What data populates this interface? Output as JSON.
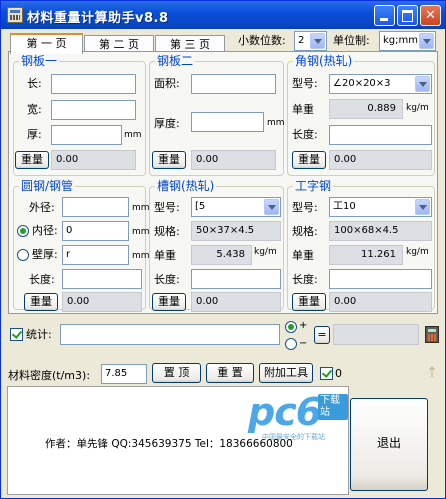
{
  "window": {
    "title": "材料重量计算助手v8.8"
  },
  "tabs": [
    "第 一 页",
    "第 二 页",
    "第 三 页"
  ],
  "toolbar": {
    "decimals_label": "小数位数:",
    "decimals_value": "2",
    "unit_label": "单位制:",
    "unit_value": "kg;mm"
  },
  "plate1": {
    "title": "钢板一",
    "length_label": "长:",
    "width_label": "宽:",
    "thickness_label": "厚:",
    "thickness_unit": "mm",
    "button": "重量",
    "result": "0.00"
  },
  "plate2": {
    "title": "钢板二",
    "area_label": "面积:",
    "thickness_label": "厚度:",
    "thickness_unit": "mm",
    "button": "重量",
    "result": "0.00"
  },
  "angle": {
    "title": "角钢(热轧)",
    "model_label": "型号:",
    "model_value": "∠20×20×3",
    "unit_weight_label": "单重",
    "unit_weight_value": "0.889",
    "unit_weight_unit": "kg/m",
    "length_label": "长度:",
    "button": "重量",
    "result": "0.00"
  },
  "pipe": {
    "title": "圆钢/钢管",
    "outer_label": "外径:",
    "outer_unit": "mm",
    "inner_label": "内径:",
    "inner_value": "0",
    "inner_unit": "mm",
    "wall_label": "壁厚:",
    "wall_value": "r",
    "wall_unit": "mm",
    "length_label": "长度:",
    "button": "重量",
    "result": "0.00"
  },
  "channel": {
    "title": "槽钢(热轧)",
    "model_label": "型号:",
    "model_value": "[5",
    "spec_label": "规格:",
    "spec_value": "50×37×4.5",
    "unit_weight_label": "单重",
    "unit_weight_value": "5.438",
    "unit_weight_unit": "kg/m",
    "length_label": "长度:",
    "button": "重量",
    "result": "0.00"
  },
  "ibeam": {
    "title": "工字钢",
    "model_label": "型号:",
    "model_value": "工10",
    "spec_label": "规格:",
    "spec_value": "100×68×4.5",
    "unit_weight_label": "单重",
    "unit_weight_value": "11.261",
    "unit_weight_unit": "kg/m",
    "length_label": "长度:",
    "button": "重量",
    "result": "0.00"
  },
  "stats": {
    "label": "统计:",
    "plus": "+",
    "minus": "−",
    "equals": "="
  },
  "density": {
    "label": "材料密度(t/m3):",
    "value": "7.85",
    "pin_button": "置 顶",
    "reset_button": "重 置",
    "tools_button": "附加工具",
    "check_value": "0"
  },
  "footer": {
    "author": "作者：单先锋 QQ:345639375  Tel：18366660800",
    "watermark_main": "pc6",
    "watermark_tag": "下载站",
    "watermark_sub": "中国最安全的下载站",
    "exit_button": "退出"
  },
  "colors": {
    "title_bar": "#0a4fd8",
    "group_label": "#0046d5",
    "readonly_bg": "#dcdfe4"
  }
}
